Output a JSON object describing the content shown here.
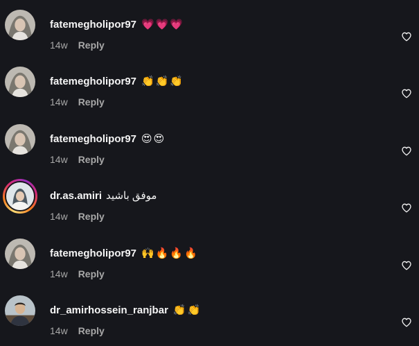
{
  "comments": [
    {
      "username": "fatemegholipor97",
      "text": "💗💗💗",
      "time": "14w",
      "reply_label": "Reply",
      "avatar_icon": "profile-photo-woman",
      "story_ring": false
    },
    {
      "username": "fatemegholipor97",
      "text": "👏👏👏",
      "time": "14w",
      "reply_label": "Reply",
      "avatar_icon": "profile-photo-woman",
      "story_ring": false
    },
    {
      "username": "fatemegholipor97",
      "text": "😍😍",
      "time": "14w",
      "reply_label": "Reply",
      "avatar_icon": "profile-photo-woman",
      "story_ring": false
    },
    {
      "username": "dr.as.amiri",
      "text": "موفق باشید",
      "time": "14w",
      "reply_label": "Reply",
      "avatar_icon": "profile-photo-hijab",
      "story_ring": true
    },
    {
      "username": "fatemegholipor97",
      "text": "🙌🔥🔥🔥",
      "time": "14w",
      "reply_label": "Reply",
      "avatar_icon": "profile-photo-woman",
      "story_ring": false
    },
    {
      "username": "dr_amirhossein_ranjbar",
      "text": "👏👏",
      "time": "14w",
      "reply_label": "Reply",
      "avatar_icon": "profile-photo-man",
      "story_ring": false
    }
  ],
  "icons": {
    "like": "heart-outline-icon"
  },
  "colors": {
    "background": "#16171c",
    "text": "#f5f5f5",
    "muted": "#a8a8a8"
  }
}
